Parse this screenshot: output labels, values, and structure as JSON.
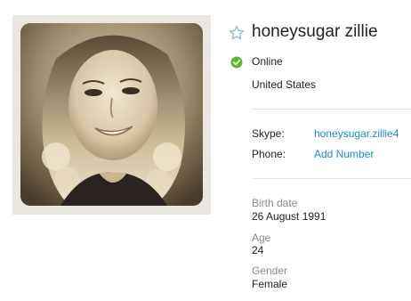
{
  "profile": {
    "display_name": "honeysugar zillie",
    "status": "Online",
    "location": "United States",
    "favorite_icon": "star-outline-icon",
    "status_icon": "online-check-icon",
    "colors": {
      "link": "#1a8ccf",
      "online": "#5cb82a",
      "muted_label": "#8a8a8a",
      "star": "#8fb8d8"
    }
  },
  "contact": {
    "skype_label": "Skype:",
    "skype_value": "honeysugar.zillie4",
    "phone_label": "Phone:",
    "phone_action": "Add Number"
  },
  "details": {
    "birth_label": "Birth date",
    "birth_value": "26 August 1991",
    "age_label": "Age",
    "age_value": "24",
    "gender_label": "Gender",
    "gender_value": "Female"
  }
}
